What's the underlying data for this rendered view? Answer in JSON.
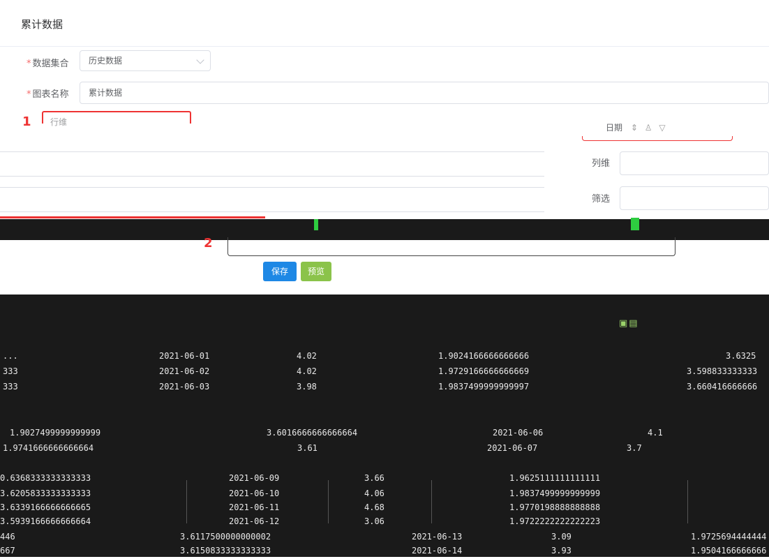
{
  "panel": {
    "title": "累计数据"
  },
  "form": {
    "dataset": {
      "label": "数据集合",
      "value": "历史数据"
    },
    "chart_name": {
      "label": "图表名称",
      "value": "累计数据"
    },
    "row_dim": {
      "label": "行维"
    },
    "col_dim": {
      "label": "列维"
    },
    "filter": {
      "label": "筛选"
    }
  },
  "markers": {
    "one": "1",
    "two": "2"
  },
  "field_chip": {
    "label": "日期"
  },
  "actions": {
    "save": "保存",
    "preview": "预览"
  },
  "colors": {
    "primary": "#1e88e5",
    "success": "#8bc34a",
    "danger": "#e33333",
    "band": "#1a1a1a"
  },
  "table": {
    "rows_top": [
      {
        "date": "2021-06-01",
        "a": "4.02",
        "b": "1.9024166666666666",
        "c": "3.6325"
      },
      {
        "date": "2021-06-02",
        "a": "4.02",
        "b": "1.9729166666666669",
        "c": "3.598833333333"
      },
      {
        "date": "2021-06-03",
        "a": "3.98",
        "b": "1.9837499999999997",
        "c": "3.660416666666"
      }
    ],
    "rows_mid": [
      {
        "c1": "1.9027499999999999",
        "c2": "3.6016666666666664",
        "date": "2021-06-06",
        "a": "4.1"
      },
      {
        "c1": "1.9741666666666664",
        "c2": "3.61",
        "date": "2021-06-07",
        "a": "3.7"
      }
    ],
    "rows_bottom": [
      {
        "c0": "0.6368333333333333",
        "date": "2021-06-09",
        "a": "3.66",
        "b": "1.9625111111111111"
      },
      {
        "c0": "3.6205833333333333",
        "date": "2021-06-10",
        "a": "4.06",
        "b": "1.9837499999999999"
      },
      {
        "c0": "3.6339166666666665",
        "date": "2021-06-11",
        "a": "4.68",
        "b": "1.9770198888888888"
      },
      {
        "c0": "3.5939166666666664",
        "date": "2021-06-12",
        "a": "3.06",
        "b": "1.9722222222222223"
      }
    ],
    "rows_last": [
      {
        "c0": "446",
        "c1": "3.6117500000000002",
        "date": "2021-06-13",
        "a": "3.09",
        "b": "1.9725694444444"
      },
      {
        "c0": "667",
        "c1": "3.6150833333333333",
        "date": "2021-06-14",
        "a": "3.93",
        "b": "1.9504166666666"
      }
    ]
  }
}
